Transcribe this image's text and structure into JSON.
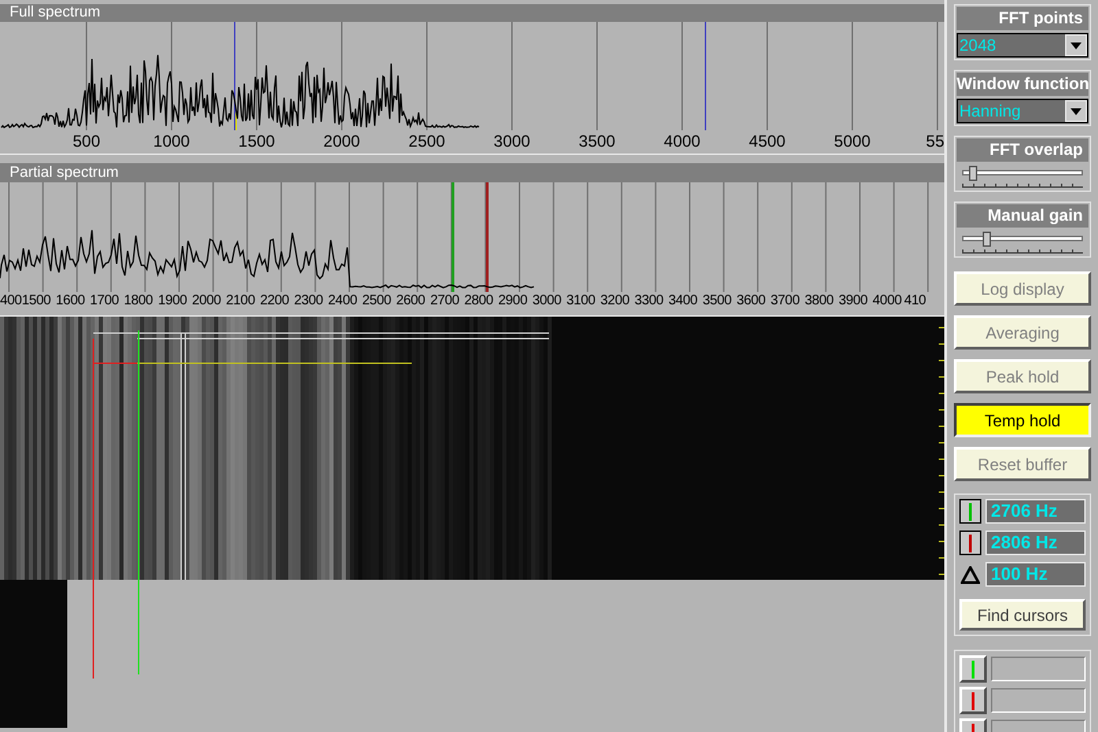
{
  "full_spectrum": {
    "title": "Full spectrum",
    "axis_labels": [
      "500",
      "1000",
      "1500",
      "2000",
      "2500",
      "3000",
      "3500",
      "4000",
      "4500",
      "5000",
      "55"
    ]
  },
  "partial_spectrum": {
    "title": "Partial spectrum",
    "axis_labels": [
      "400",
      "1500",
      "1600",
      "1700",
      "1800",
      "1900",
      "2000",
      "2100",
      "2200",
      "2300",
      "2400",
      "2500",
      "2600",
      "2700",
      "2800",
      "2900",
      "3000",
      "3100",
      "3200",
      "3300",
      "3400",
      "3500",
      "3600",
      "3700",
      "3800",
      "3900",
      "4000",
      "410"
    ]
  },
  "fft_points": {
    "label": "FFT points",
    "value": "2048"
  },
  "window_function": {
    "label": "Window function",
    "value": "Hanning"
  },
  "fft_overlap": {
    "label": "FFT overlap",
    "level": 0.08
  },
  "manual_gain": {
    "label": "Manual gain",
    "level": 0.2
  },
  "toggles": [
    {
      "label": "Log display",
      "on": false
    },
    {
      "label": "Averaging",
      "on": false
    },
    {
      "label": "Peak hold",
      "on": false
    },
    {
      "label": "Temp hold",
      "on": true
    },
    {
      "label": "Reset buffer",
      "on": false
    }
  ],
  "cursors": [
    {
      "kind": "marker",
      "color": "#00c000",
      "value": "2706 Hz"
    },
    {
      "kind": "marker",
      "color": "#c00000",
      "value": "2806 Hz"
    },
    {
      "kind": "delta",
      "value": "100 Hz"
    }
  ],
  "find_cursors": "Find cursors",
  "memory_rows": [
    {
      "color": "#00e000"
    },
    {
      "color": "#e00000"
    },
    {
      "color": "#e00000"
    }
  ]
}
